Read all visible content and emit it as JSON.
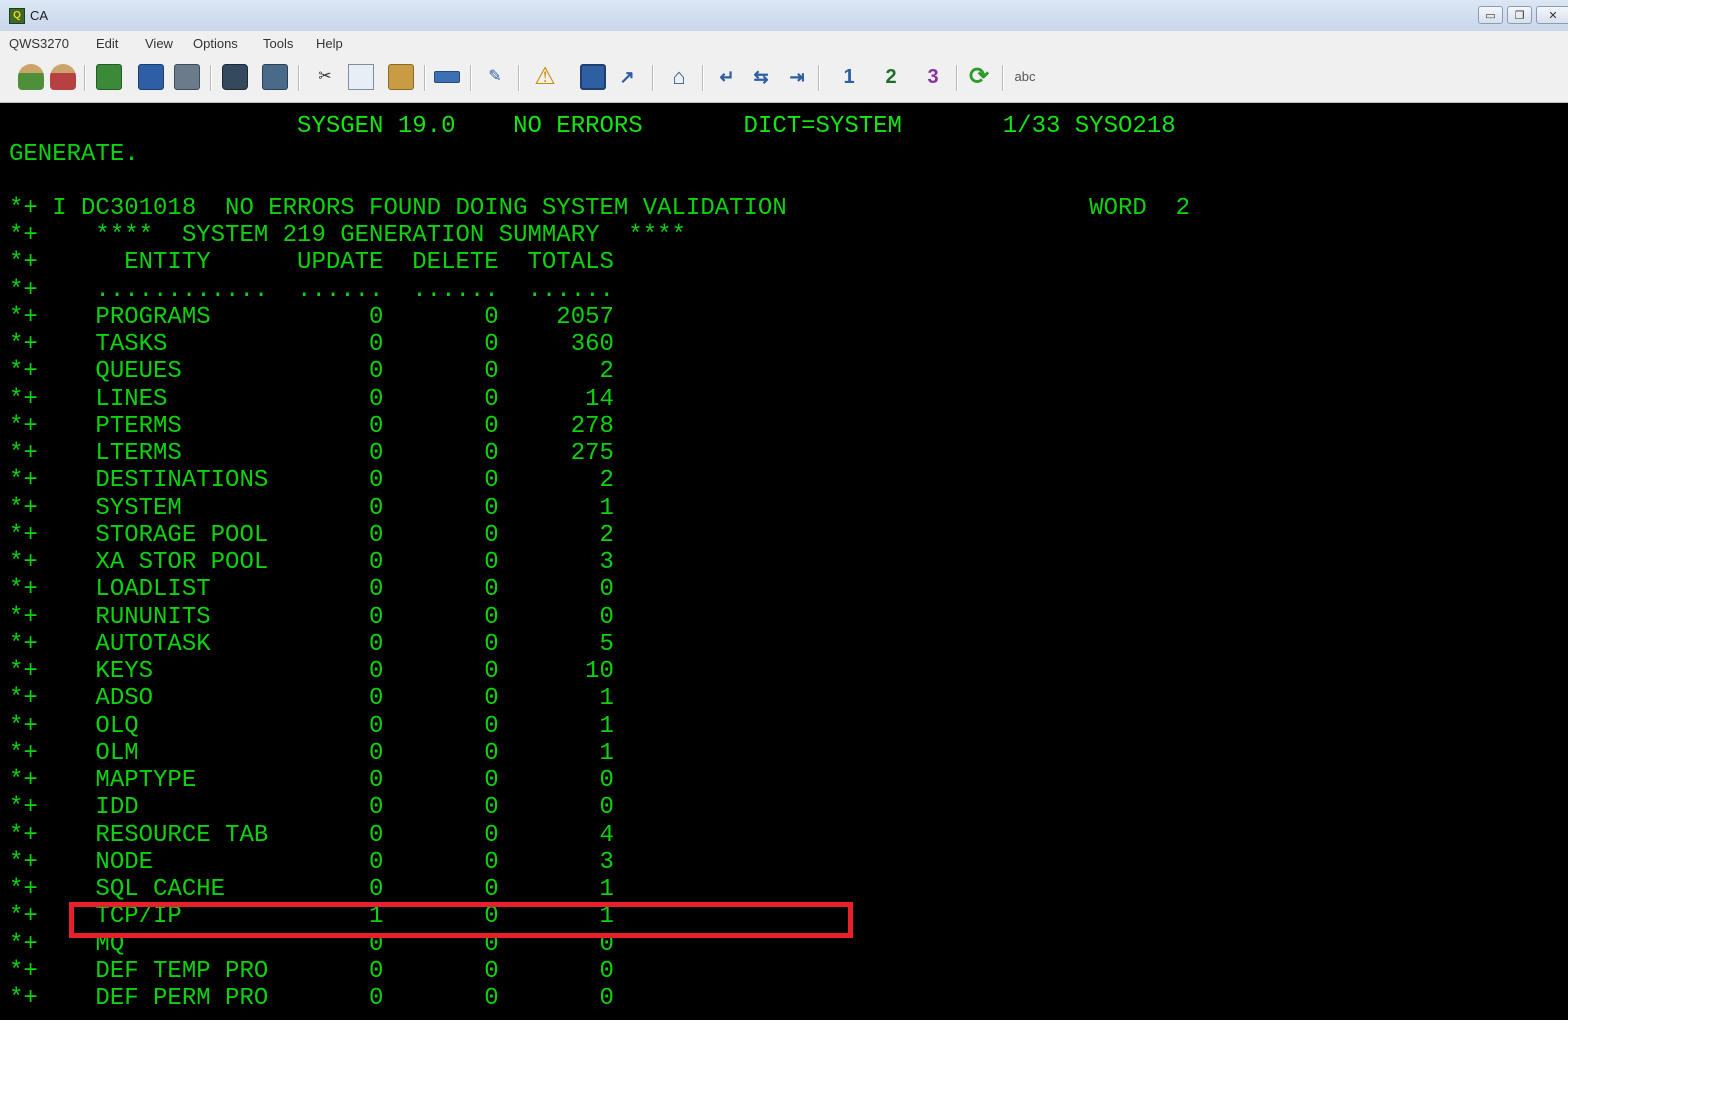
{
  "window": {
    "title": "CA",
    "controls": [
      "minimize",
      "restore",
      "close"
    ]
  },
  "menu": {
    "items": [
      "QWS3270",
      "Edit",
      "View",
      "Options",
      "Tools",
      "Help"
    ]
  },
  "toolbar": {
    "buttons": [
      {
        "name": "connect-icon"
      },
      {
        "name": "disconnect-icon"
      },
      {
        "name": "run-icon"
      },
      {
        "name": "save-icon"
      },
      {
        "name": "print-icon"
      },
      {
        "name": "screenshot-icon"
      },
      {
        "name": "capture-icon"
      },
      {
        "name": "cut-icon"
      },
      {
        "name": "copy-icon"
      },
      {
        "name": "paste-icon"
      },
      {
        "name": "keyboard-icon"
      },
      {
        "name": "edit-icon"
      },
      {
        "name": "warning-icon"
      },
      {
        "name": "monitor-icon"
      },
      {
        "name": "transfer-icon"
      },
      {
        "name": "home-icon"
      },
      {
        "name": "enter-icon"
      },
      {
        "name": "field-icon"
      },
      {
        "name": "tab-icon"
      },
      {
        "name": "pa1-icon",
        "label": "1"
      },
      {
        "name": "pa2-icon",
        "label": "2"
      },
      {
        "name": "pa3-icon",
        "label": "3"
      },
      {
        "name": "refresh-icon"
      },
      {
        "name": "spellcheck-icon",
        "label": "abc"
      }
    ]
  },
  "terminal": {
    "lines": [
      "                    SYSGEN 19.0    NO ERRORS       DICT=SYSTEM       1/33 SYSO218",
      "GENERATE.",
      "",
      "*+ I DC301018  NO ERRORS FOUND DOING SYSTEM VALIDATION                     WORD  2",
      "*+    ****  SYSTEM 219 GENERATION SUMMARY  ****",
      "*+      ENTITY      UPDATE  DELETE  TOTALS",
      "*+    ............  ......  ......  ......",
      "*+    PROGRAMS           0       0    2057",
      "*+    TASKS              0       0     360",
      "*+    QUEUES             0       0       2",
      "*+    LINES              0       0      14",
      "*+    PTERMS             0       0     278",
      "*+    LTERMS             0       0     275",
      "*+    DESTINATIONS       0       0       2",
      "*+    SYSTEM             0       0       1",
      "*+    STORAGE POOL       0       0       2",
      "*+    XA STOR POOL       0       0       3",
      "*+    LOADLIST           0       0       0",
      "*+    RUNUNITS           0       0       0",
      "*+    AUTOTASK           0       0       5",
      "*+    KEYS               0       0      10",
      "*+    ADSO               0       0       1",
      "*+    OLQ                0       0       1",
      "*+    OLM                0       0       1",
      "*+    MAPTYPE            0       0       0",
      "*+    IDD                0       0       0",
      "*+    RESOURCE TAB       0       0       4",
      "*+    NODE               0       0       3",
      "*+    SQL CACHE          0       0       1",
      "*+    TCP/IP             1       0       1",
      "*+    MQ                 0       0       0",
      "*+    DEF TEMP PRO       0       0       0",
      "*+    DEF PERM PRO       0       0       0"
    ]
  },
  "annotation": {
    "highlight_color": "#e8202a"
  }
}
